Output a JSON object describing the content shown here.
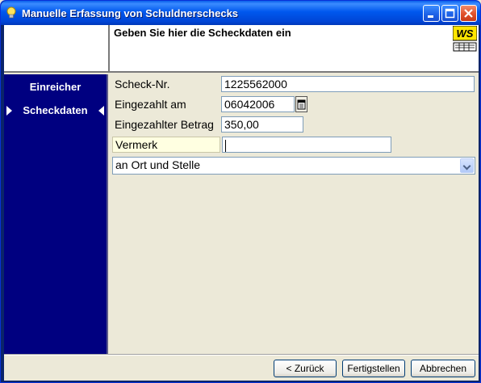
{
  "window": {
    "title": "Manuelle Erfassung von Schuldnerschecks",
    "title_icon": "lightbulb-icon",
    "controls": [
      "minimize",
      "maximize",
      "close"
    ]
  },
  "header": {
    "title": "Geben Sie hier die Scheckdaten ein",
    "logo_text": "WS"
  },
  "sidebar": {
    "items": [
      {
        "label": "Einreicher",
        "active": false
      },
      {
        "label": "Scheckdaten",
        "active": true
      }
    ]
  },
  "form": {
    "scheck_nr": {
      "label": "Scheck-Nr.",
      "value": "1225562000"
    },
    "eingezahlt_am": {
      "label": "Eingezahlt am",
      "value": "06042006"
    },
    "betrag": {
      "label": "Eingezahlter Betrag",
      "value": "350,00"
    },
    "vermerk": {
      "label": "Vermerk",
      "value": ""
    },
    "ort": {
      "value": "an Ort und Stelle"
    }
  },
  "buttons": {
    "back": "< Zurück",
    "finish": "Fertigstellen",
    "cancel": "Abbrechen"
  },
  "colors": {
    "sidebar_bg": "#000080",
    "titlebar": "#0058EE",
    "vermerk_highlight": "#FFFFE1"
  }
}
